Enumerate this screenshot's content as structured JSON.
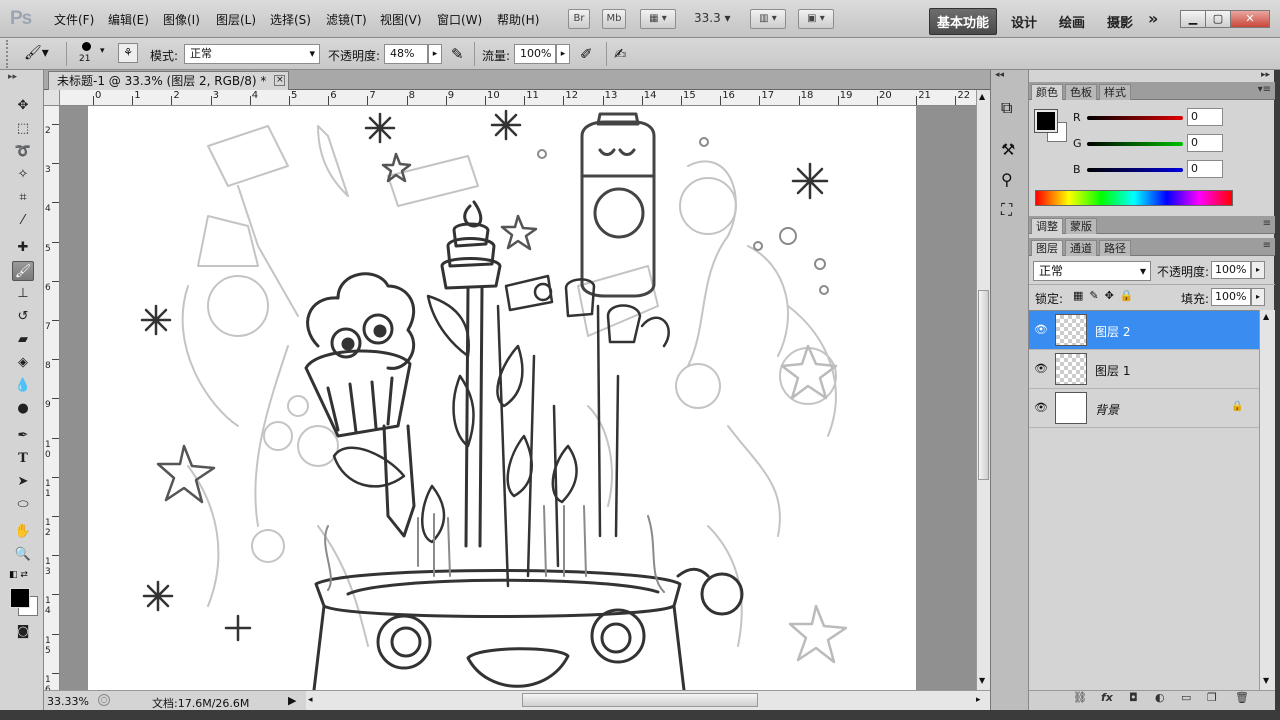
{
  "app": {
    "logo": "Ps"
  },
  "menu": [
    "文件(F)",
    "编辑(E)",
    "图像(I)",
    "图层(L)",
    "选择(S)",
    "滤镜(T)",
    "视图(V)",
    "窗口(W)",
    "帮助(H)"
  ],
  "appbar": {
    "bridge": "Br",
    "minibridge": "Mb",
    "zoom": "33.3"
  },
  "workspaces": [
    "基本功能",
    "设计",
    "绘画",
    "摄影"
  ],
  "workspace_more": "»",
  "options": {
    "brush_size": "21",
    "mode_label": "模式:",
    "mode_value": "正常",
    "opacity_label": "不透明度:",
    "opacity_value": "48%",
    "flow_label": "流量:",
    "flow_value": "100%"
  },
  "document": {
    "tab_title": "未标题-1 @ 33.3% (图层 2, RGB/8) *",
    "close": "×",
    "ruler_h": [
      "0",
      "1",
      "2",
      "3",
      "4",
      "5",
      "6",
      "7",
      "8",
      "9",
      "10",
      "11",
      "12",
      "13",
      "14",
      "15",
      "16",
      "17",
      "18",
      "19",
      "20",
      "21",
      "22"
    ],
    "ruler_v": [
      "2",
      "3",
      "4",
      "5",
      "6",
      "7",
      "8",
      "9",
      "1\n0",
      "1\n1",
      "1\n2",
      "1\n3",
      "1\n4",
      "1\n5",
      "1\n6"
    ]
  },
  "status": {
    "zoom": "33.33%",
    "doc": "文档:17.6M/26.6M"
  },
  "color_panel": {
    "tabs": [
      "颜色",
      "色板",
      "样式"
    ],
    "channels": [
      {
        "label": "R",
        "value": "0",
        "color": "#cc0000"
      },
      {
        "label": "G",
        "value": "0",
        "color": "#00aa00"
      },
      {
        "label": "B",
        "value": "0",
        "color": "#0000cc"
      }
    ]
  },
  "adjust_panel": {
    "tabs": [
      "调整",
      "蒙版"
    ]
  },
  "layers_panel": {
    "tabs": [
      "图层",
      "通道",
      "路径"
    ],
    "blend_mode": "正常",
    "opacity_label": "不透明度:",
    "opacity_value": "100%",
    "lock_label": "锁定:",
    "fill_label": "填充:",
    "fill_value": "100%",
    "layers": [
      {
        "name": "图层 2",
        "selected": true,
        "thumb": "transparent"
      },
      {
        "name": "图层 1",
        "selected": false,
        "thumb": "transparent"
      },
      {
        "name": "背景",
        "selected": false,
        "thumb": "white",
        "locked": true
      }
    ]
  },
  "colors": {
    "foreground": "#000000",
    "background": "#ffffff",
    "selection": "#3a8df0"
  }
}
